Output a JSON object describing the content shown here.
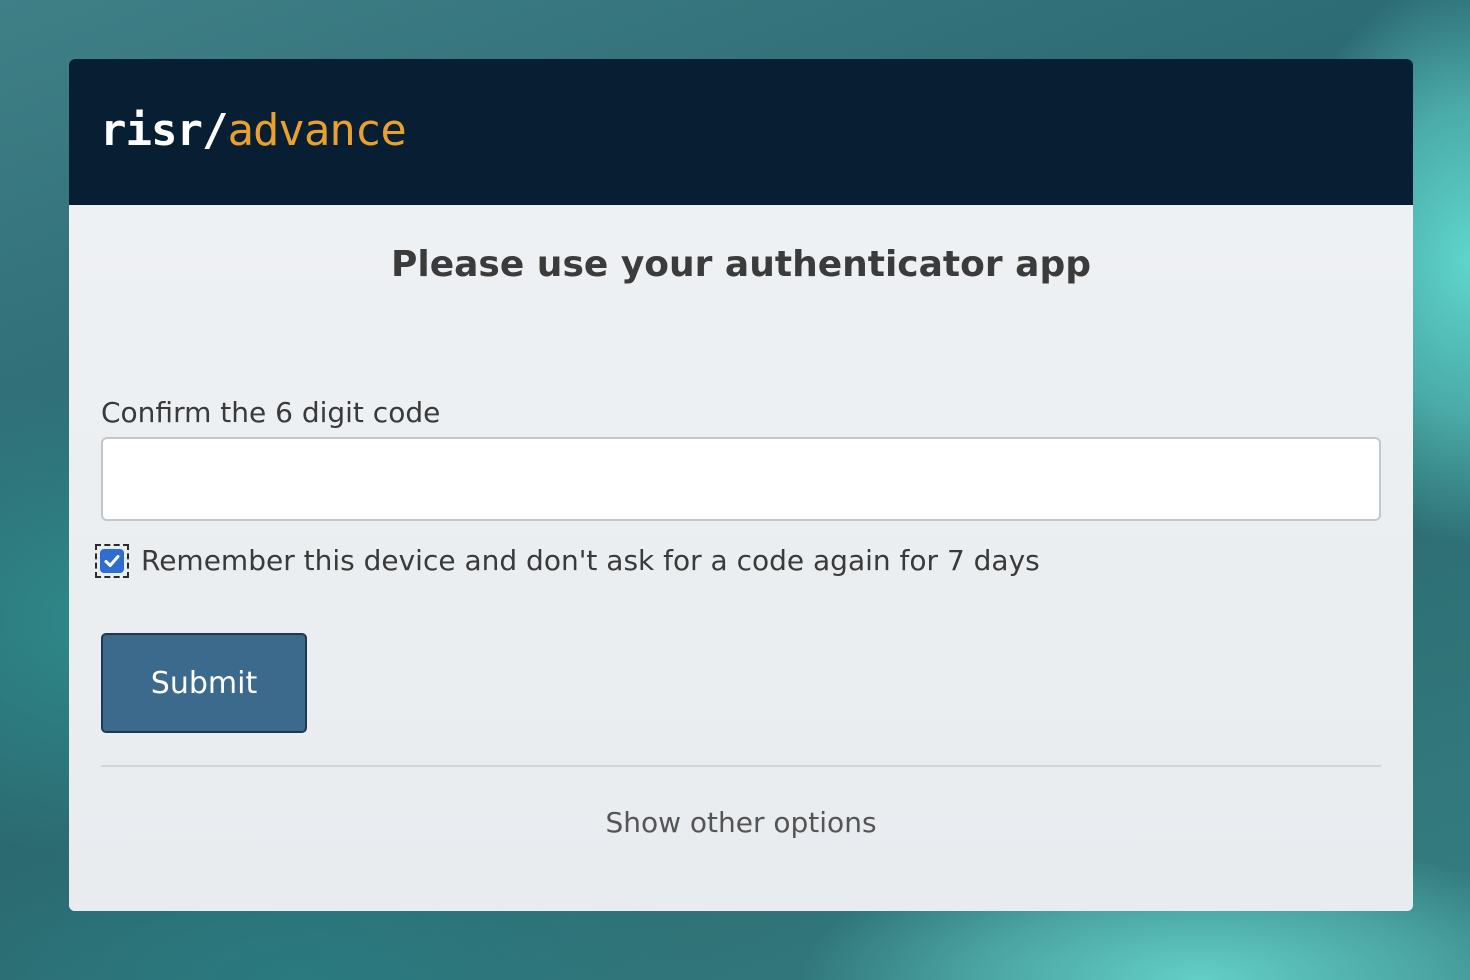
{
  "brand": {
    "name_main": "risr/",
    "name_accent": "advance",
    "main_color": "#ffffff",
    "accent_color": "#e8a02e",
    "header_color": "#071e33"
  },
  "page": {
    "title": "Please use your authenticator app"
  },
  "form": {
    "code_label": "Confirm the 6 digit code",
    "code_value": "",
    "remember_checked": true,
    "remember_label": "Remember this device and don't ask for a code again for 7 days",
    "submit_label": "Submit",
    "submit_color": "#3c6a8c"
  },
  "footer": {
    "other_options_label": "Show other options"
  },
  "icons": {
    "checkbox": "checkmark-icon"
  }
}
